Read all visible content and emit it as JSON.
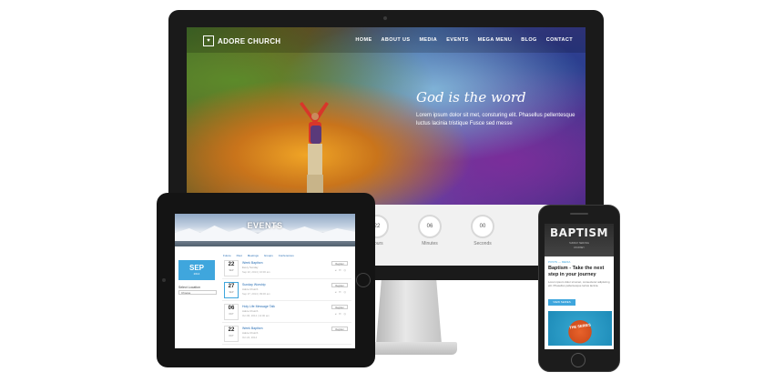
{
  "desktop": {
    "logo": {
      "bold": "ADORE",
      "light": " CHURCH"
    },
    "nav": [
      "HOME",
      "ABOUT US",
      "MEDIA",
      "EVENTS",
      "MEGA MENU",
      "BLOG",
      "CONTACT"
    ],
    "hero_title": "God is the word",
    "hero_text": "Lorem ipsum dolor sit met, consturing elit. Phasellus pellentesque luctus lacinia tristique Fusce sed messe",
    "countdown": [
      {
        "value": "22",
        "label": "Hours"
      },
      {
        "value": "06",
        "label": "Minutes"
      },
      {
        "value": "00",
        "label": "Seconds"
      }
    ]
  },
  "tablet": {
    "banner_title": "EVENTS",
    "tabs": [
      "Future",
      "Past",
      "Meetings",
      "Groups",
      "Conferences"
    ],
    "month": {
      "name": "SEP",
      "year": "2014"
    },
    "side_label": "Select Location",
    "side_select": "Choose",
    "events": [
      {
        "day": "22",
        "month": "SEP",
        "title": "Week Baptism",
        "meta": "Every Sunday",
        "meta2": "Sep 22, 2014 | 10:00 am",
        "button": "Register"
      },
      {
        "day": "27",
        "month": "SEP",
        "title": "Sunday Worship",
        "meta": "Adore Church",
        "meta2": "Sep 27, 2014 | 09:00 am",
        "button": "Register"
      },
      {
        "day": "06",
        "month": "OCT",
        "title": "Holy Life Message Talk",
        "meta": "Adore Church",
        "meta2": "Oct 06, 2014 | 11:00 am",
        "button": "Register"
      },
      {
        "day": "22",
        "month": "OCT",
        "title": "Week Baptism",
        "meta": "Adore Church",
        "meta2": "Oct 22, 2014",
        "button": "Register"
      }
    ]
  },
  "phone": {
    "hero_title": "BAPTISM",
    "hero_sub": "SUNDAY SERVICE",
    "hero_sub2": "JOURNEY",
    "category": "POSTS — MEDIA",
    "title": "Baptism - Take the next step in your journey",
    "body": "Lorem ipsum dolor sit amet, consectetur adipiscing elit. Phasellus pellentesque luctus lacinia.",
    "button": "VIEW SERIES",
    "promo": "THE SERIES"
  }
}
